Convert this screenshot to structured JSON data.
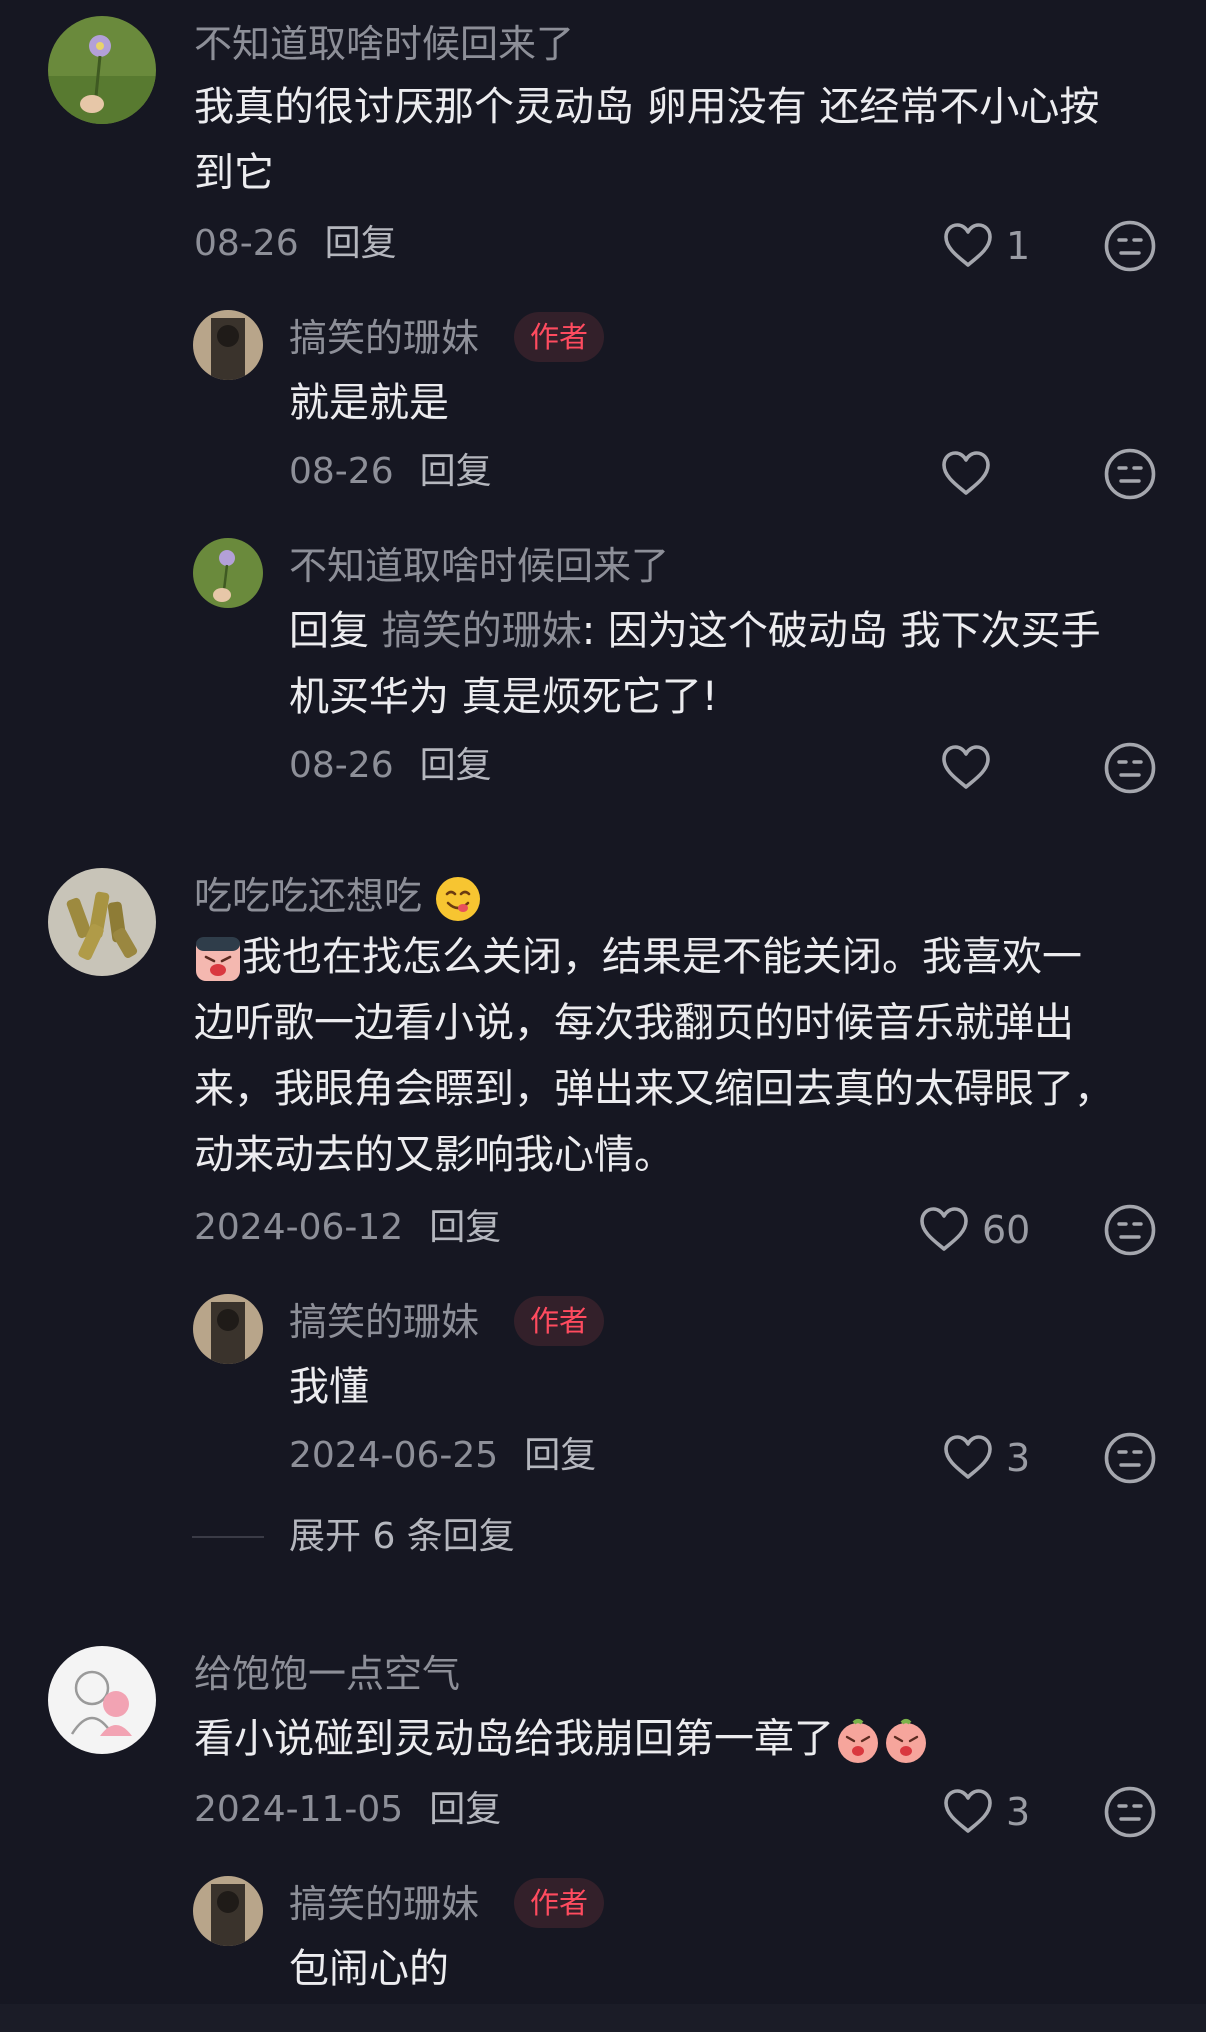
{
  "comments": [
    {
      "user": "不知道取啥时候回来了",
      "lines": [
        "我真的很讨厌那个灵动岛 卵用没有 还经常不小心按",
        "到它"
      ],
      "date": "08-26",
      "reply": "回复",
      "likes": "1",
      "replies": [
        {
          "user": "搞笑的珊妹",
          "badge": "作者",
          "text": "就是就是",
          "date": "08-26",
          "reply": "回复",
          "likes": ""
        },
        {
          "user": "不知道取啥时候回来了",
          "reply_prefix": "回复",
          "reply_to": "搞笑的珊妹",
          "text_line1": ": 因为这个破动岛 我下次买手",
          "text_line2": "机买华为 真是烦死它了!",
          "date": "08-26",
          "reply": "回复",
          "likes": ""
        }
      ]
    },
    {
      "user": "吃吃吃还想吃",
      "lines": [
        "我也在找怎么关闭，结果是不能关闭。我喜欢一",
        "边听歌一边看小说，每次我翻页的时候音乐就弹出",
        "来，我眼角会瞟到，弹出来又缩回去真的太碍眼了，",
        "动来动去的又影响我心情。"
      ],
      "date": "2024-06-12",
      "reply": "回复",
      "likes": "60",
      "replies": [
        {
          "user": "搞笑的珊妹",
          "badge": "作者",
          "text": "我懂",
          "date": "2024-06-25",
          "reply": "回复",
          "likes": "3"
        }
      ],
      "expand": "展开 6 条回复"
    },
    {
      "user": "给饱饱一点空气",
      "lines": [
        "看小说碰到灵动岛给我崩回第一章了"
      ],
      "date": "2024-11-05",
      "reply": "回复",
      "likes": "3",
      "replies": [
        {
          "user": "搞笑的珊妹",
          "badge": "作者",
          "text": "包闹心的"
        }
      ]
    }
  ],
  "icons": {
    "like": "heart-outline-icon",
    "emoji": "neutral-face-icon"
  },
  "colors": {
    "background": "#161722",
    "author_badge_bg": "#33202a",
    "author_badge_text": "#ff4b5f"
  }
}
